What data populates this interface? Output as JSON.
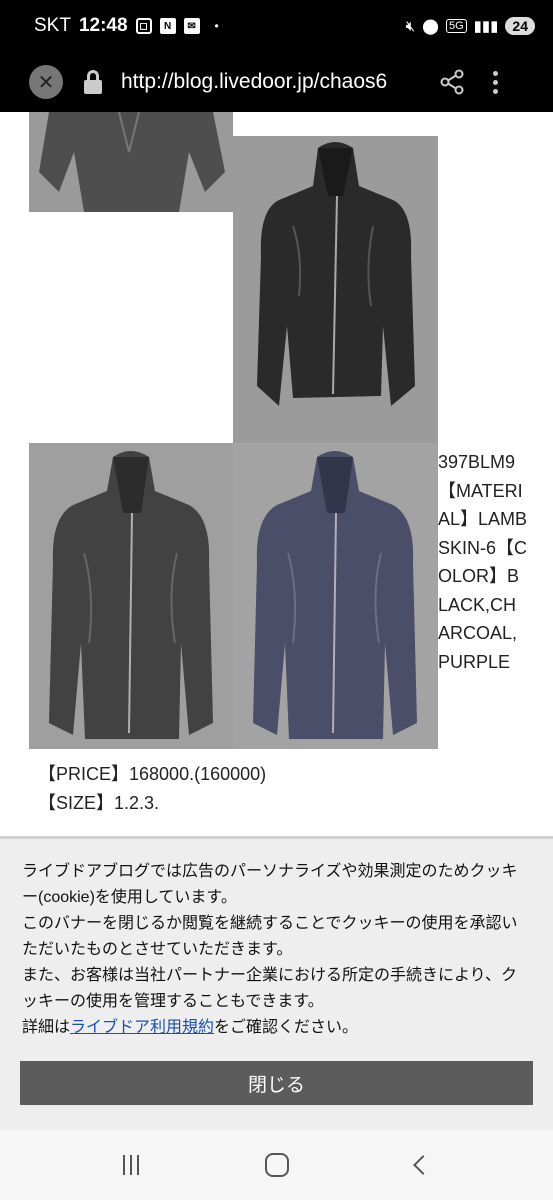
{
  "status_bar": {
    "carrier": "SKT",
    "time": "12:48",
    "notification_icons": [
      "screenshot-icon",
      "n-app-icon",
      "mail-icon",
      "dot-icon"
    ],
    "network": "5G",
    "battery": "24"
  },
  "browser": {
    "url": "http://blog.livedoor.jp/chaos6"
  },
  "article": {
    "side_text": "397BLM9【MATERIAL】LAMBSKIN-6【COLOR】BLACK,CHARCOAL,PURPLE",
    "price_line": "【PRICE】168000.(160000)",
    "size_line": "【SIZE】1.2.3.",
    "photos": [
      {
        "name": "jacket-photo-top-crop",
        "color": "#5a5a5a"
      },
      {
        "name": "jacket-photo-black",
        "color": "#2e2e2e"
      },
      {
        "name": "jacket-photo-charcoal",
        "color": "#444444"
      },
      {
        "name": "jacket-photo-purple",
        "color": "#4a4d64"
      }
    ]
  },
  "cookie_banner": {
    "line1": "ライブドアブログでは広告のパーソナライズや効果測定のためクッキー(cookie)を使用しています。",
    "line2": "このバナーを閉じるか閲覧を継続することでクッキーの使用を承認いただいたものとさせていただきます。",
    "line3": "また、お客様は当社パートナー企業における所定の手続きにより、クッキーの使用を管理することもできます。",
    "line4_prefix": "詳細は",
    "line4_link": "ライブドア利用規約",
    "line4_suffix": "をご確認ください。",
    "close_label": "閉じる"
  },
  "nav_bar": {
    "items": [
      "recents-icon",
      "home-icon",
      "back-icon"
    ]
  }
}
